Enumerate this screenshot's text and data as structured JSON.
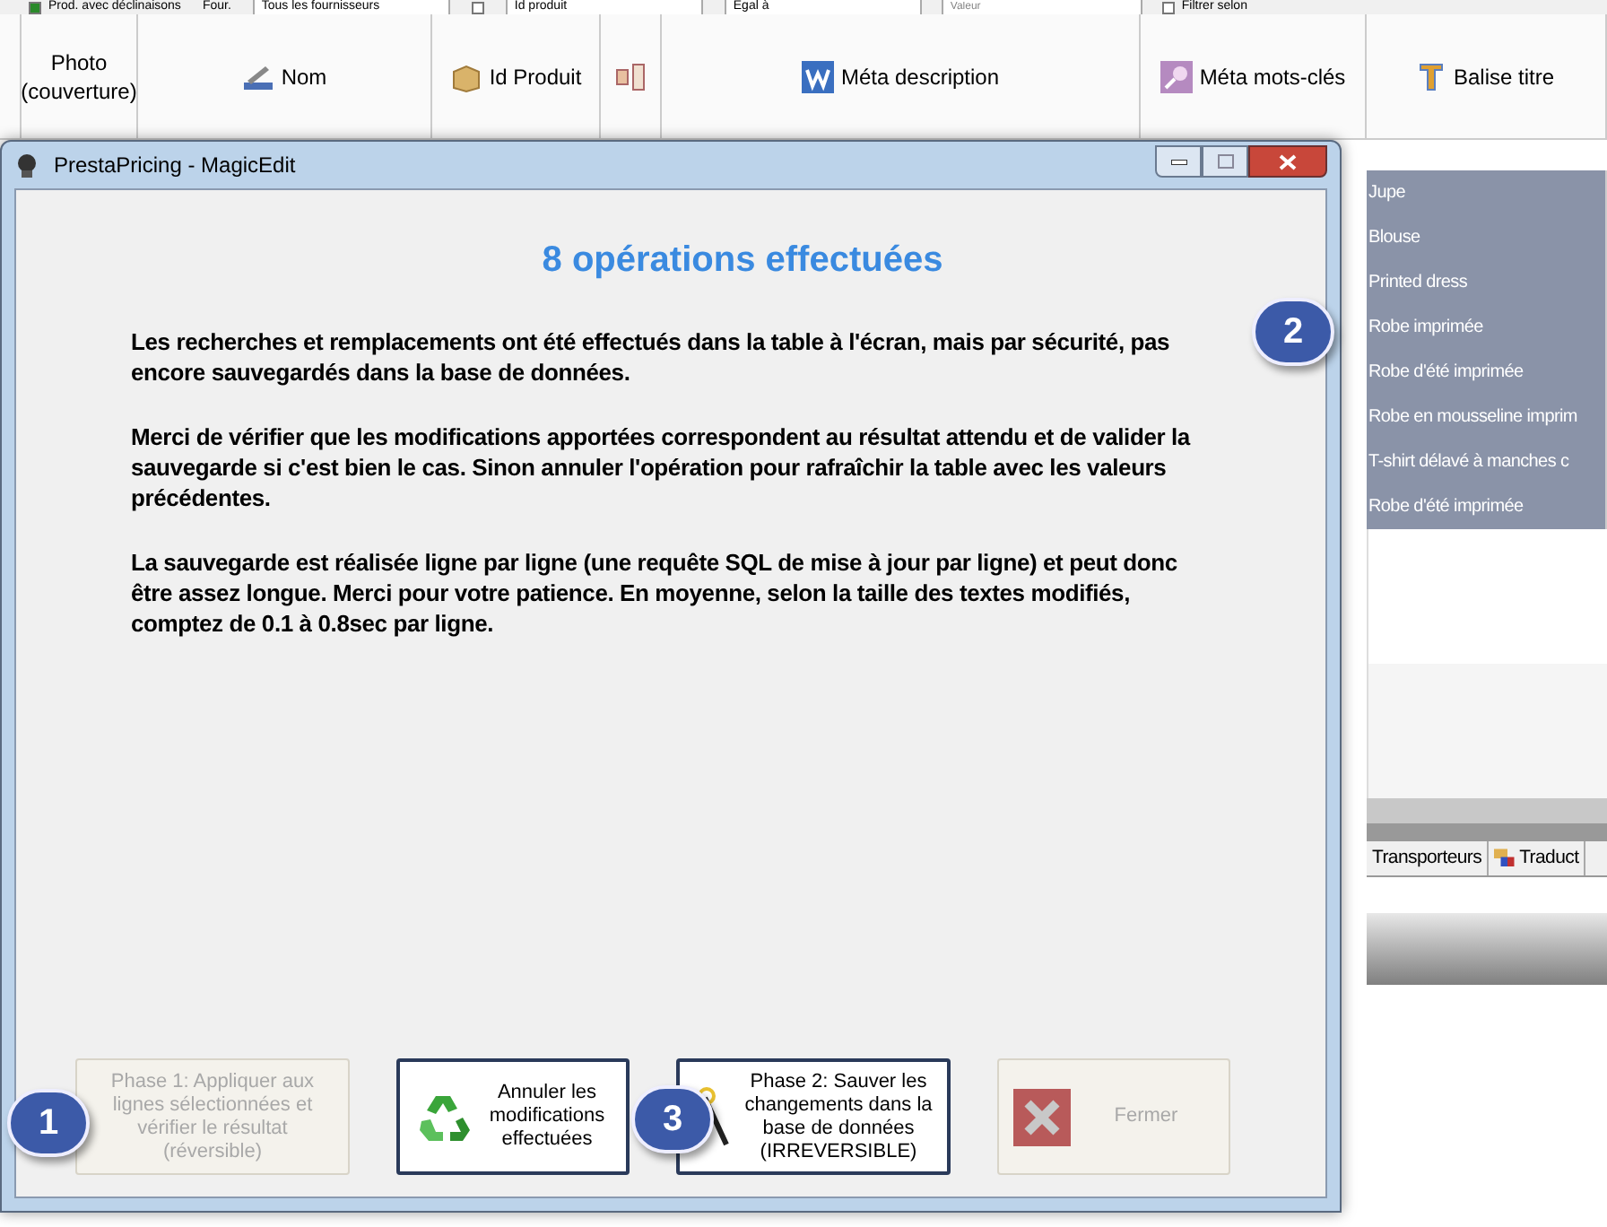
{
  "toolbar": [
    {
      "kind": "checkbox",
      "label": "Prod. avec déclinaisons",
      "checked": true
    },
    {
      "kind": "label",
      "label": "Four."
    },
    {
      "kind": "select",
      "value": "Tous les fournisseurs"
    },
    {
      "kind": "checkbox",
      "checked": false
    },
    {
      "kind": "select",
      "value": "Id produit"
    },
    {
      "kind": "select",
      "value": "Egal à"
    },
    {
      "kind": "field",
      "placeholder": "Valeur"
    },
    {
      "kind": "checkbox",
      "label": "Filtrer selon",
      "checked": false
    }
  ],
  "grid": {
    "columns": [
      "Photo (couverture)",
      "Nom",
      "Id Produit",
      "",
      "Méta description",
      "Méta mots-clés",
      "Balise titre"
    ],
    "rows": [
      {
        "title": "Jupe",
        "selected": true
      },
      {
        "title": "Blouse",
        "selected": true
      },
      {
        "title": "Printed dress",
        "selected": true
      },
      {
        "title": "Robe imprimée",
        "selected": true
      },
      {
        "title": "Robe d'été imprimée",
        "selected": true
      },
      {
        "title": "Robe en mousseline imprim",
        "selected": true
      },
      {
        "title": "T-shirt délavé à  manches c",
        "selected": true
      },
      {
        "title": "Robe d'été imprimée",
        "selected": true
      }
    ]
  },
  "tabs": [
    {
      "label": "Transporteurs",
      "selected": false
    },
    {
      "label": "Traduct",
      "selected": false
    }
  ],
  "dialog": {
    "title": "PrestaPricing - MagicEdit",
    "heading": "8  opérations effectuées",
    "paragraphs": [
      "Les recherches et remplacements ont été effectués dans la table à l'écran, mais par sécurité, pas encore sauvegardés dans la base de données.",
      "Merci de vérifier que les modifications apportées correspondent au résultat attendu et de valider la sauvegarde si c'est bien le cas. Sinon annuler l'opération pour rafraîchir la table avec les valeurs précédentes.",
      "La sauvegarde est réalisée ligne par ligne (une requête SQL de mise à jour par ligne) et peut donc être assez longue. Merci pour votre patience. En moyenne, selon la taille des textes modifiés, comptez de 0.1 à 0.8sec par ligne."
    ],
    "buttons": [
      {
        "label": "Phase 1: Appliquer aux lignes sélectionnées et vérifier le résultat (réversible)",
        "disabled": true
      },
      {
        "label": "Annuler les modifications effectuées",
        "disabled": false
      },
      {
        "label": "Phase 2: Sauver les changements dans la base de données (IRREVERSIBLE)",
        "disabled": false
      },
      {
        "label": "Fermer",
        "disabled": true
      }
    ]
  },
  "callouts": [
    "1",
    "2",
    "3"
  ]
}
